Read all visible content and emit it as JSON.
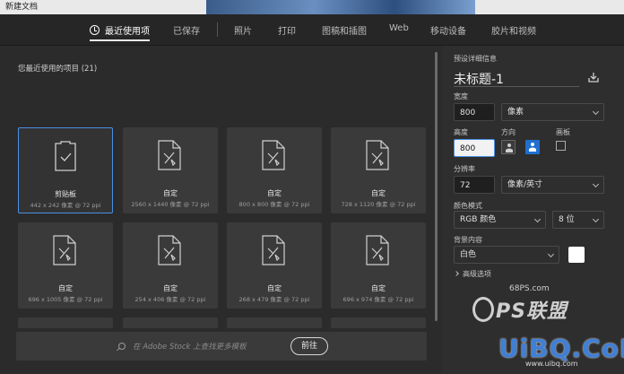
{
  "window": {
    "title": "新建文档"
  },
  "tabs": [
    {
      "label": "最近使用项",
      "active": true
    },
    {
      "label": "已保存"
    },
    {
      "label": "照片"
    },
    {
      "label": "打印"
    },
    {
      "label": "图稿和插图"
    },
    {
      "label": "Web"
    },
    {
      "label": "移动设备"
    },
    {
      "label": "胶片和视频"
    }
  ],
  "recent": {
    "title": "您最近使用的项目",
    "count": "(21)",
    "items": [
      {
        "name": "剪贴板",
        "meta": "442 x 242 像素 @ 72 ppi",
        "selected": true,
        "icon": "clipboard-icon"
      },
      {
        "name": "自定",
        "meta": "2560 x 1440 像素 @ 72 ppi",
        "icon": "custom-doc-icon"
      },
      {
        "name": "自定",
        "meta": "800 x 800 像素 @ 72 ppi",
        "icon": "custom-doc-icon"
      },
      {
        "name": "自定",
        "meta": "728 x 1120 像素 @ 72 ppi",
        "icon": "custom-doc-icon"
      },
      {
        "name": "自定",
        "meta": "696 x 1005 像素 @ 72 ppi",
        "icon": "custom-doc-icon"
      },
      {
        "name": "自定",
        "meta": "254 x 406 像素 @ 72 ppi",
        "icon": "custom-doc-icon"
      },
      {
        "name": "自定",
        "meta": "268 x 479 像素 @ 72 ppi",
        "icon": "custom-doc-icon"
      },
      {
        "name": "自定",
        "meta": "696 x 974 像素 @ 72 ppi",
        "icon": "custom-doc-icon"
      }
    ]
  },
  "stock": {
    "placeholder": "在 Adobe Stock 上查找更多模板",
    "go_label": "前往"
  },
  "preset": {
    "section_title": "预设详细信息",
    "doc_name": "未标题-1",
    "width_label": "宽度",
    "width_value": "800",
    "width_unit": "像素",
    "height_label": "高度",
    "height_value": "800",
    "orientation_label": "方向",
    "artboard_label": "画板",
    "resolution_label": "分辨率",
    "resolution_value": "72",
    "resolution_unit": "像素/英寸",
    "color_mode_label": "颜色模式",
    "color_mode_value": "RGB 颜色",
    "bit_depth_value": "8 位",
    "background_label": "背景内容",
    "background_value": "白色",
    "background_color": "#ffffff",
    "advanced_label": "高级选项"
  },
  "watermark": {
    "site": "68PS.com",
    "logo_text": "PS联盟",
    "brand": "UiBQ.CoM",
    "url": "www.uibq.com"
  },
  "colors": {
    "accent": "#4a90e2",
    "orientation_active": "#1f6fd0"
  }
}
